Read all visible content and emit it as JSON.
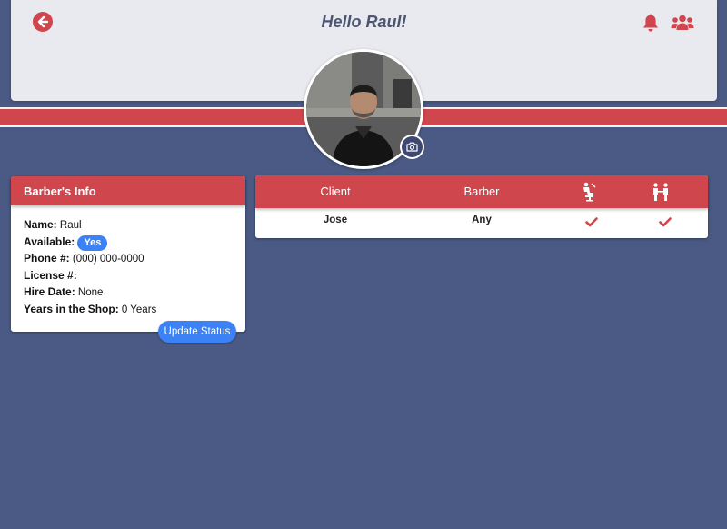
{
  "header": {
    "greeting": "Hello Raul!",
    "back_icon": "arrow-left-icon",
    "notifications_icon": "bell-icon",
    "people_icon": "users-icon"
  },
  "profile": {
    "photo_icon": "camera-icon"
  },
  "barber_info": {
    "title": "Barber's Info",
    "name_label": "Name:",
    "name_value": "Raul",
    "available_label": "Available:",
    "available_value": "Yes",
    "phone_label": "Phone #:",
    "phone_value": "(000) 000-0000",
    "license_label": "License #:",
    "license_value": "",
    "hire_date_label": "Hire Date:",
    "hire_date_value": "None",
    "years_label": "Years in the Shop:",
    "years_value": "0 Years",
    "update_button": "Update Status"
  },
  "queue": {
    "columns": [
      "Client",
      "Barber"
    ],
    "icon_columns": [
      "haircut-chair-icon",
      "handshake-icon"
    ],
    "rows": [
      {
        "client": "Jose",
        "barber": "Any",
        "seated": true,
        "served": true
      }
    ]
  },
  "colors": {
    "background": "#4a5a84",
    "accent_red": "#cf464d",
    "header_bg": "#e9e9f0",
    "badge_blue": "#3b82f6"
  }
}
